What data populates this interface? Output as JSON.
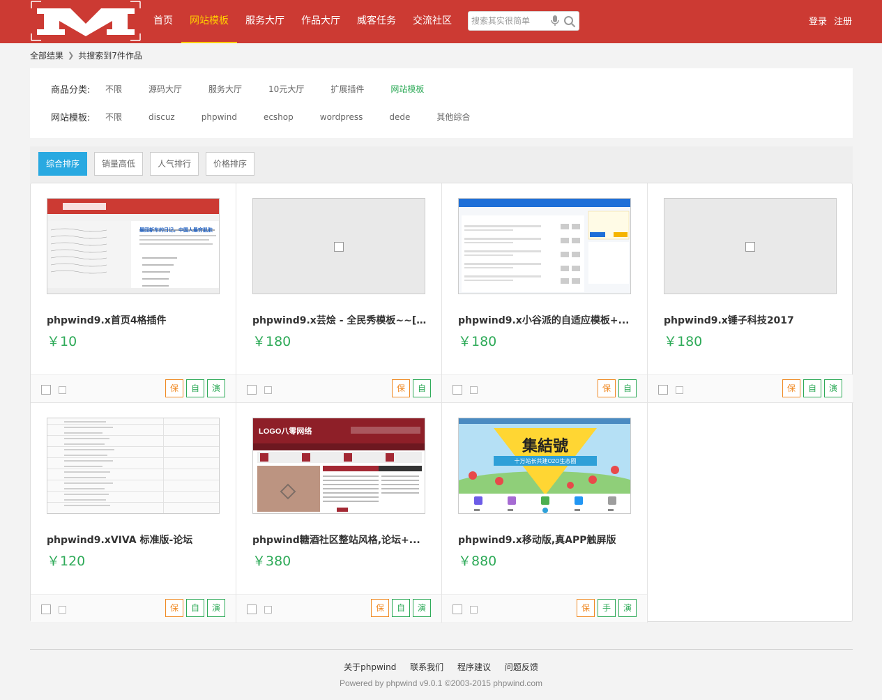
{
  "header": {
    "nav": [
      "首页",
      "网站模板",
      "服务大厅",
      "作品大厅",
      "威客任务",
      "交流社区"
    ],
    "search_placeholder": "搜索其实很简单",
    "login": "登录",
    "register": "注册"
  },
  "breadcrumb": {
    "root": "全部结果",
    "result": "共搜索到7件作品"
  },
  "filters": {
    "category_label": "商品分类:",
    "categories": [
      "不限",
      "源码大厅",
      "服务大厅",
      "10元大厅",
      "扩展插件",
      "网站模板"
    ],
    "template_label": "网站模板:",
    "templates": [
      "不限",
      "discuz",
      "phpwind",
      "ecshop",
      "wordpress",
      "dede",
      "其他综合"
    ]
  },
  "sort": [
    "综合排序",
    "销量高低",
    "人气排行",
    "价格排序"
  ],
  "products": [
    {
      "title": "phpwind9.x首页4格插件",
      "price": "￥10",
      "badges": [
        "保",
        "自",
        "演"
      ],
      "thumb": "red-portal"
    },
    {
      "title": "phpwind9.x芸烩 - 全民秀模板~~[...",
      "price": "￥180",
      "badges": [
        "保",
        "自"
      ],
      "thumb": "broken"
    },
    {
      "title": "phpwind9.x小谷派的自适应模板+...",
      "price": "￥180",
      "badges": [
        "保",
        "自"
      ],
      "thumb": "blue-forum"
    },
    {
      "title": "phpwind9.x锤子科技2017",
      "price": "￥180",
      "badges": [
        "保",
        "自",
        "演"
      ],
      "thumb": "broken"
    },
    {
      "title": "phpwind9.xVIVA 标准版-论坛",
      "price": "￥120",
      "badges": [
        "保",
        "自",
        "演"
      ],
      "thumb": "list"
    },
    {
      "title": "phpwind糖酒社区整站风格,论坛+...",
      "price": "￥380",
      "badges": [
        "保",
        "自",
        "演"
      ],
      "thumb": "dark-red"
    },
    {
      "title": "phpwind9.x移动版,真APP触屏版",
      "price": "￥880",
      "badges": [
        "保",
        "手",
        "演"
      ],
      "thumb": "mobile"
    }
  ],
  "thumb_text": {
    "red_portal_headline": "最囧新车的日记，中国人最穷肌肤",
    "mobile_heading": "集結號",
    "mobile_ribbon": "十万站长共建O2O生态圈",
    "dark_red_logo": "LOGO八零网络"
  },
  "footer": {
    "links": [
      "关于phpwind",
      "联系我们",
      "程序建议",
      "问题反馈"
    ],
    "copyright": "Powered by phpwind v9.0.1 ©2003-2015 phpwind.com"
  },
  "colors": {
    "header_bg": "#cc3a33",
    "nav_active": "#ffcc00",
    "price_green": "#2eaa58",
    "sort_active": "#29a9e1",
    "badge_orange": "#f08a24"
  }
}
